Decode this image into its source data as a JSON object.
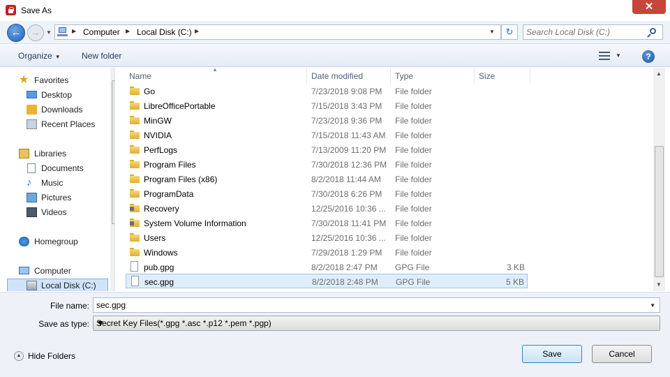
{
  "window": {
    "title": "Save As",
    "close_glyph": "✕"
  },
  "address": {
    "crumbs": [
      "Computer",
      "Local Disk (C:)"
    ],
    "search_placeholder": "Search Local Disk (C:)"
  },
  "toolbar": {
    "organize_label": "Organize",
    "new_folder_label": "New folder",
    "help_glyph": "?"
  },
  "nav": {
    "favorites": {
      "label": "Favorites",
      "items": [
        "Desktop",
        "Downloads",
        "Recent Places"
      ]
    },
    "libraries": {
      "label": "Libraries",
      "items": [
        "Documents",
        "Music",
        "Pictures",
        "Videos"
      ]
    },
    "homegroup": "Homegroup",
    "computer": {
      "label": "Computer",
      "items": [
        "Local Disk (C:)"
      ]
    }
  },
  "list": {
    "columns": [
      "Name",
      "Date modified",
      "Type",
      "Size"
    ],
    "rows": [
      {
        "name": "Go",
        "date": "7/23/2018 9:08 PM",
        "type": "File folder",
        "size": "",
        "icon": "folder-icon"
      },
      {
        "name": "LibreOfficePortable",
        "date": "7/15/2018 3:43 PM",
        "type": "File folder",
        "size": "",
        "icon": "folder-icon"
      },
      {
        "name": "MinGW",
        "date": "7/23/2018 9:36 PM",
        "type": "File folder",
        "size": "",
        "icon": "folder-icon"
      },
      {
        "name": "NVIDIA",
        "date": "7/15/2018 11:43 AM",
        "type": "File folder",
        "size": "",
        "icon": "folder-icon"
      },
      {
        "name": "PerfLogs",
        "date": "7/13/2009 11:20 PM",
        "type": "File folder",
        "size": "",
        "icon": "folder-icon"
      },
      {
        "name": "Program Files",
        "date": "7/30/2018 12:36 PM",
        "type": "File folder",
        "size": "",
        "icon": "folder-icon"
      },
      {
        "name": "Program Files (x86)",
        "date": "8/2/2018 11:44 AM",
        "type": "File folder",
        "size": "",
        "icon": "folder-icon"
      },
      {
        "name": "ProgramData",
        "date": "7/30/2018 6:26 PM",
        "type": "File folder",
        "size": "",
        "icon": "folder-icon"
      },
      {
        "name": "Recovery",
        "date": "12/25/2016 10:36 ...",
        "type": "File folder",
        "size": "",
        "icon": "locked-folder-icon"
      },
      {
        "name": "System Volume Information",
        "date": "7/30/2018 11:41 PM",
        "type": "File folder",
        "size": "",
        "icon": "locked-folder-icon"
      },
      {
        "name": "Users",
        "date": "12/25/2016 10:36 ...",
        "type": "File folder",
        "size": "",
        "icon": "folder-icon"
      },
      {
        "name": "Windows",
        "date": "7/29/2018 1:29 PM",
        "type": "File folder",
        "size": "",
        "icon": "folder-icon"
      },
      {
        "name": "pub.gpg",
        "date": "8/2/2018 2:47 PM",
        "type": "GPG File",
        "size": "3 KB",
        "icon": "file-icon"
      },
      {
        "name": "sec.gpg",
        "date": "8/2/2018 2:48 PM",
        "type": "GPG File",
        "size": "5 KB",
        "icon": "file-icon"
      }
    ],
    "selected_row": "sec.gpg"
  },
  "form": {
    "file_name_label": "File name:",
    "file_name_value": "sec.gpg",
    "save_type_label": "Save as type:",
    "save_type_value": "Secret Key Files(*.gpg *.asc *.p12 *.pem *.pgp)",
    "hide_folders_label": "Hide Folders",
    "save_label": "Save",
    "cancel_label": "Cancel"
  },
  "colors": {
    "accent": "#3c7fb1",
    "selection": "#dfeefc",
    "close": "#c7453a"
  }
}
